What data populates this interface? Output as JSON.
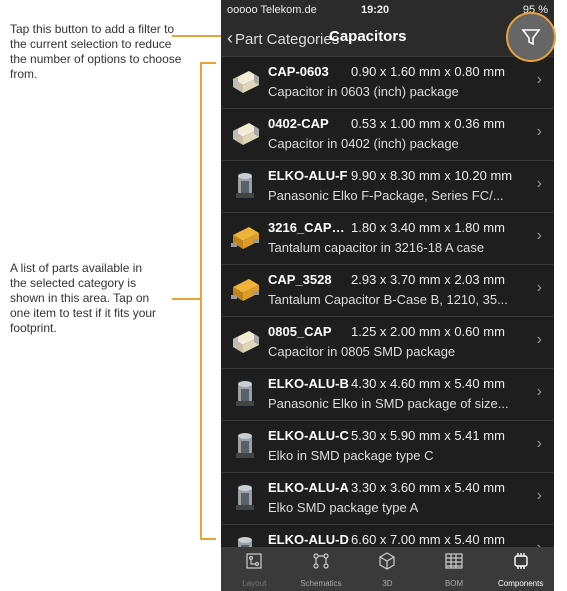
{
  "annotations": {
    "filter": "Tap this button to add a filter to the current selection to reduce the number of options to choose from.",
    "list": "A list of parts available in the selected category is shown in this area. Tap on one item to test if it fits your footprint."
  },
  "status": {
    "carrier": "ooooo Telekom.de",
    "time": "19:20",
    "battery": "95 %"
  },
  "nav": {
    "back_label": "Part Categories",
    "title": "Capacitors"
  },
  "parts": [
    {
      "name": "CAP-0603",
      "dims": "0.90 x 1.60 mm x 0.80 mm",
      "desc": "Capacitor in 0603 (inch) package",
      "icon": "ceramic-chip-icon"
    },
    {
      "name": "0402-CAP",
      "dims": "0.53 x 1.00 mm x 0.36 mm",
      "desc": "Capacitor in 0402 (inch) package",
      "icon": "ceramic-chip-icon"
    },
    {
      "name": "ELKO-ALU-F",
      "dims": "9.90 x 8.30 mm x 10.20 mm",
      "desc": "Panasonic Elko F-Package, Series FC/...",
      "icon": "electrolytic-cap-icon"
    },
    {
      "name": "3216_CAP_A...",
      "dims": "1.80 x 3.40 mm x 1.80 mm",
      "desc": "Tantalum capacitor in 3216-18 A case",
      "icon": "tantalum-cap-icon"
    },
    {
      "name": "CAP_3528",
      "dims": "2.93 x 3.70 mm x 2.03 mm",
      "desc": "Tantalum Capacitor B-Case B, 1210, 35...",
      "icon": "tantalum-cap-icon"
    },
    {
      "name": "0805_CAP",
      "dims": "1.25 x 2.00 mm x 0.60 mm",
      "desc": "Capacitor in 0805 SMD package",
      "icon": "ceramic-chip-icon"
    },
    {
      "name": "ELKO-ALU-B",
      "dims": "4.30 x 4.60 mm x 5.40 mm",
      "desc": "Panasonic Elko in SMD package of size...",
      "icon": "electrolytic-cap-icon"
    },
    {
      "name": "ELKO-ALU-C",
      "dims": "5.30 x 5.90 mm x 5.41 mm",
      "desc": "Elko in SMD package type C",
      "icon": "electrolytic-cap-icon"
    },
    {
      "name": "ELKO-ALU-A",
      "dims": "3.30 x 3.60 mm x 5.40 mm",
      "desc": "Elko SMD package type A",
      "icon": "electrolytic-cap-icon"
    },
    {
      "name": "ELKO-ALU-D",
      "dims": "6.60 x 7.00 mm x 5.40 mm",
      "desc": "",
      "icon": "electrolytic-cap-icon"
    }
  ],
  "tabs": [
    {
      "label": "Layout",
      "icon": "layout-icon",
      "state": "dim"
    },
    {
      "label": "Schematics",
      "icon": "schematics-icon",
      "state": "normal"
    },
    {
      "label": "3D",
      "icon": "cube-icon",
      "state": "normal"
    },
    {
      "label": "BOM",
      "icon": "bom-grid-icon",
      "state": "normal"
    },
    {
      "label": "Components",
      "icon": "chip-icon",
      "state": "active"
    }
  ],
  "colors": {
    "accent": "#e8a23a",
    "background": "#1e1e1e",
    "tabbar": "#3a3a3a"
  }
}
